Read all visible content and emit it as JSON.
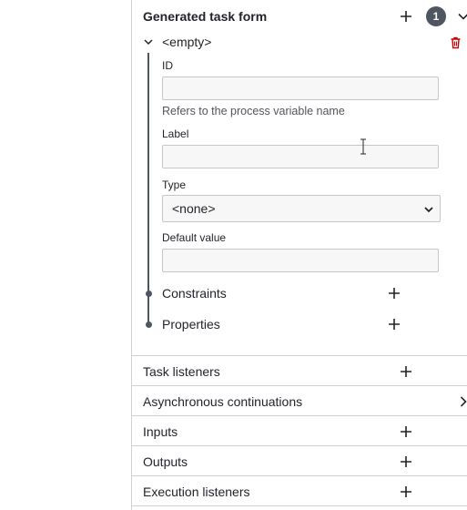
{
  "form_section": {
    "title": "Generated task form",
    "badge_count": "1",
    "add_icon": "plus-icon",
    "toggle_icon": "chevron-down-icon"
  },
  "form_field": {
    "title": "<empty>",
    "collapse_icon": "chevron-down-icon",
    "delete_icon": "trash-icon",
    "delete_color": "#cc0000",
    "id": {
      "label": "ID",
      "value": "",
      "description": "Refers to the process variable name"
    },
    "label_field": {
      "label": "Label",
      "value": ""
    },
    "type": {
      "label": "Type",
      "selected": "<none>"
    },
    "default_value": {
      "label": "Default value",
      "value": ""
    },
    "groups": [
      {
        "label": "Constraints",
        "icon": "plus-icon"
      },
      {
        "label": "Properties",
        "icon": "plus-icon"
      }
    ]
  },
  "sections": [
    {
      "label": "Task listeners",
      "icon": "plus-icon"
    },
    {
      "label": "Asynchronous continuations",
      "icon": "chevron-right-icon"
    },
    {
      "label": "Inputs",
      "icon": "plus-icon"
    },
    {
      "label": "Outputs",
      "icon": "plus-icon"
    },
    {
      "label": "Execution listeners",
      "icon": "plus-icon"
    }
  ],
  "colors": {
    "text": "#22242a",
    "badge": "#505562",
    "tree_line": "#505562",
    "divider": "#d0d0d0",
    "input_bg": "#f7f7f8"
  }
}
